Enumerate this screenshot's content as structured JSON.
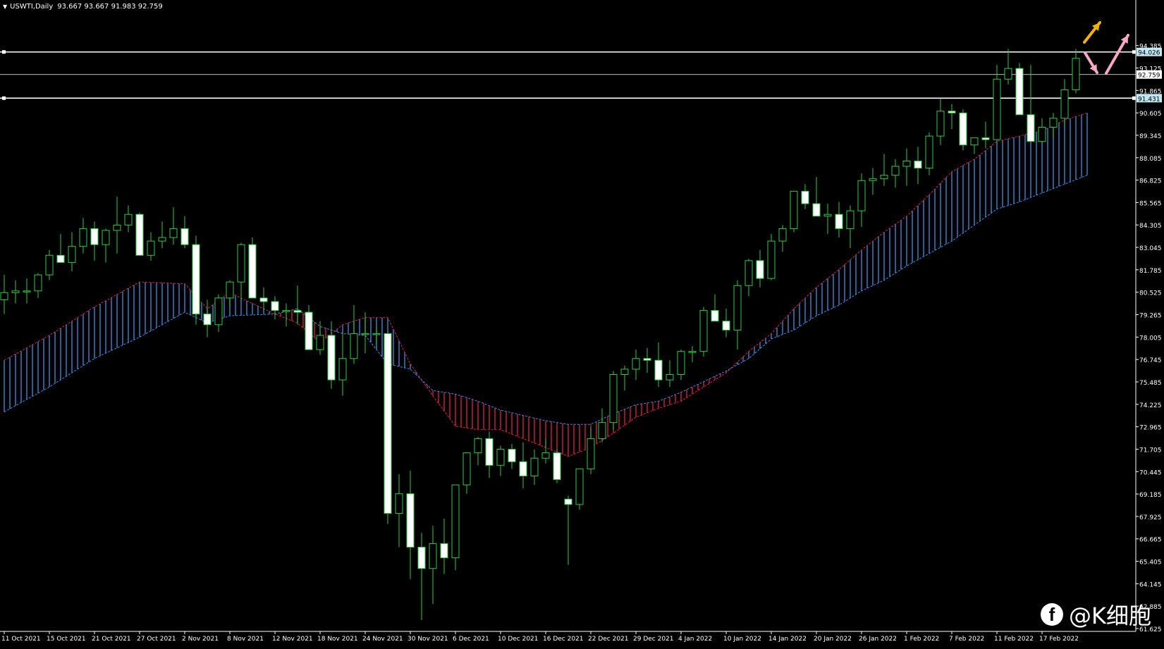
{
  "header": {
    "symbol_label": "USWTI,Daily",
    "ohlc_label": "93.667 93.667 91.983 92.759"
  },
  "watermark": {
    "icon": "facebook-icon",
    "text": "@K细胞"
  },
  "colors": {
    "background": "#000000",
    "bull_candle": "#000000",
    "bear_candle": "#ffffff",
    "wick": "#2ecc40",
    "cloud_bull": "#3d8fe6",
    "cloud_bear": "#e0214a",
    "hline": "#ffffff",
    "arrow_up_yellow": "#f0b400",
    "arrow_pink": "#f7a8c8",
    "axis_text": "#ffffff"
  },
  "chart_data": {
    "type": "candlestick",
    "symbol": "USWTI",
    "timeframe": "Daily",
    "ylim": [
      61.625,
      95.6
    ],
    "y_ticks": [
      "94.385",
      "93.125",
      "91.865",
      "90.605",
      "89.345",
      "88.085",
      "86.825",
      "85.565",
      "84.305",
      "83.045",
      "81.785",
      "80.525",
      "79.265",
      "78.005",
      "76.745",
      "75.485",
      "74.225",
      "72.965",
      "71.705",
      "70.445",
      "69.185",
      "67.925",
      "66.665",
      "65.405",
      "64.145",
      "62.885",
      "61.625"
    ],
    "x_ticks": [
      {
        "label": "11 Oct 2021",
        "i": 0
      },
      {
        "label": "15 Oct 2021",
        "i": 4
      },
      {
        "label": "21 Oct 2021",
        "i": 8
      },
      {
        "label": "27 Oct 2021",
        "i": 12
      },
      {
        "label": "2 Nov 2021",
        "i": 16
      },
      {
        "label": "8 Nov 2021",
        "i": 20
      },
      {
        "label": "12 Nov 2021",
        "i": 24
      },
      {
        "label": "18 Nov 2021",
        "i": 28
      },
      {
        "label": "24 Nov 2021",
        "i": 32
      },
      {
        "label": "30 Nov 2021",
        "i": 36
      },
      {
        "label": "6 Dec 2021",
        "i": 40
      },
      {
        "label": "10 Dec 2021",
        "i": 44
      },
      {
        "label": "16 Dec 2021",
        "i": 48
      },
      {
        "label": "22 Dec 2021",
        "i": 52
      },
      {
        "label": "29 Dec 2021",
        "i": 56
      },
      {
        "label": "4 Jan 2022",
        "i": 60
      },
      {
        "label": "10 Jan 2022",
        "i": 64
      },
      {
        "label": "14 Jan 2022",
        "i": 68
      },
      {
        "label": "20 Jan 2022",
        "i": 72
      },
      {
        "label": "26 Jan 2022",
        "i": 76
      },
      {
        "label": "1 Feb 2022",
        "i": 80
      },
      {
        "label": "7 Feb 2022",
        "i": 84
      },
      {
        "label": "11 Feb 2022",
        "i": 88
      },
      {
        "label": "17 Feb 2022",
        "i": 92
      }
    ],
    "horizontal_levels": [
      {
        "value": 94.026,
        "label": "94.026",
        "style": "thick"
      },
      {
        "value": 92.759,
        "label": "92.759",
        "style": "thin"
      },
      {
        "value": 91.431,
        "label": "91.431",
        "style": "thick"
      }
    ],
    "candles": [
      [
        0,
        80.1,
        81.5,
        79.3,
        80.5
      ],
      [
        1,
        80.5,
        81.2,
        79.9,
        80.6
      ],
      [
        2,
        80.6,
        81.3,
        79.9,
        80.6
      ],
      [
        3,
        80.6,
        81.6,
        80.2,
        81.5
      ],
      [
        4,
        81.5,
        82.9,
        81.2,
        82.6
      ],
      [
        5,
        82.6,
        83.8,
        82.3,
        82.2
      ],
      [
        6,
        82.2,
        83.9,
        81.7,
        83.1
      ],
      [
        7,
        83.1,
        84.7,
        82.7,
        84.1
      ],
      [
        8,
        84.1,
        84.5,
        82.3,
        83.2
      ],
      [
        9,
        83.2,
        84.1,
        82.2,
        84.0
      ],
      [
        10,
        84.0,
        85.9,
        82.7,
        84.3
      ],
      [
        11,
        84.3,
        85.4,
        83.9,
        84.9
      ],
      [
        12,
        84.9,
        85.0,
        83.0,
        82.6
      ],
      [
        13,
        82.6,
        83.9,
        82.3,
        83.4
      ],
      [
        14,
        83.4,
        84.5,
        83.0,
        83.6
      ],
      [
        15,
        83.6,
        85.3,
        83.2,
        84.1
      ],
      [
        16,
        84.1,
        84.8,
        83.0,
        83.2
      ],
      [
        17,
        83.2,
        83.7,
        78.7,
        79.3
      ],
      [
        18,
        79.3,
        80.1,
        78.0,
        78.7
      ],
      [
        19,
        78.7,
        80.4,
        78.3,
        80.2
      ],
      [
        20,
        80.2,
        81.2,
        79.7,
        81.1
      ],
      [
        21,
        81.1,
        83.3,
        80.1,
        83.2
      ],
      [
        22,
        83.2,
        83.6,
        81.9,
        80.2
      ],
      [
        23,
        80.2,
        80.8,
        79.5,
        80.0
      ],
      [
        24,
        80.0,
        80.3,
        79.0,
        79.5
      ],
      [
        25,
        79.5,
        79.9,
        78.6,
        79.5
      ],
      [
        26,
        79.5,
        80.9,
        78.7,
        79.4
      ],
      [
        27,
        79.4,
        79.8,
        77.9,
        77.3
      ],
      [
        28,
        77.3,
        78.9,
        77.0,
        78.1
      ],
      [
        29,
        78.1,
        78.9,
        75.1,
        75.6
      ],
      [
        30,
        75.6,
        78.3,
        74.7,
        76.8
      ],
      [
        31,
        76.8,
        79.8,
        76.5,
        78.2
      ],
      [
        32,
        78.2,
        79.4,
        77.1,
        78.2
      ],
      [
        33,
        78.2,
        78.6,
        77.6,
        78.2
      ],
      [
        34,
        78.2,
        78.1,
        67.5,
        68.1
      ],
      [
        35,
        68.1,
        70.3,
        66.2,
        69.2
      ],
      [
        36,
        69.2,
        70.5,
        64.4,
        66.2
      ],
      [
        37,
        66.2,
        67.0,
        62.1,
        65.0
      ],
      [
        38,
        65.0,
        67.4,
        63.0,
        66.4
      ],
      [
        39,
        66.4,
        67.8,
        64.7,
        65.6
      ],
      [
        40,
        65.6,
        69.5,
        64.9,
        69.7
      ],
      [
        41,
        69.7,
        71.4,
        69.2,
        71.5
      ],
      [
        42,
        71.5,
        72.4,
        70.8,
        72.3
      ],
      [
        43,
        72.3,
        72.7,
        70.1,
        70.8
      ],
      [
        44,
        70.8,
        71.9,
        70.2,
        71.7
      ],
      [
        45,
        71.7,
        72.0,
        70.6,
        71.0
      ],
      [
        46,
        71.0,
        72.1,
        69.5,
        70.2
      ],
      [
        47,
        70.2,
        71.7,
        69.7,
        71.2
      ],
      [
        48,
        71.2,
        72.3,
        70.9,
        71.5
      ],
      [
        49,
        71.5,
        71.7,
        69.8,
        70.0
      ],
      [
        50,
        68.9,
        69.1,
        65.2,
        68.6
      ],
      [
        51,
        68.6,
        70.6,
        68.3,
        70.6
      ],
      [
        52,
        70.6,
        72.9,
        70.3,
        72.3
      ],
      [
        53,
        72.3,
        74.0,
        72.1,
        73.2
      ],
      [
        54,
        73.2,
        76.1,
        72.8,
        75.9
      ],
      [
        55,
        75.9,
        76.4,
        75.0,
        76.2
      ],
      [
        56,
        76.2,
        77.3,
        75.6,
        76.8
      ],
      [
        57,
        76.8,
        77.4,
        76.0,
        76.7
      ],
      [
        58,
        76.7,
        77.7,
        75.2,
        75.6
      ],
      [
        59,
        75.6,
        76.7,
        75.2,
        75.9
      ],
      [
        60,
        75.9,
        77.3,
        75.6,
        77.2
      ],
      [
        61,
        77.2,
        77.5,
        76.6,
        77.2
      ],
      [
        62,
        77.2,
        79.7,
        76.9,
        79.5
      ],
      [
        63,
        79.5,
        80.4,
        79.1,
        78.9
      ],
      [
        64,
        78.9,
        79.6,
        78.0,
        78.4
      ],
      [
        65,
        78.4,
        81.2,
        77.3,
        80.9
      ],
      [
        66,
        80.9,
        82.4,
        80.3,
        82.3
      ],
      [
        67,
        82.3,
        82.9,
        80.8,
        81.3
      ],
      [
        68,
        81.3,
        83.8,
        81.2,
        83.4
      ],
      [
        69,
        83.4,
        84.3,
        82.8,
        84.1
      ],
      [
        70,
        84.1,
        86.2,
        83.9,
        86.2
      ],
      [
        71,
        86.2,
        86.6,
        85.2,
        85.5
      ],
      [
        72,
        85.5,
        87.0,
        84.8,
        84.8
      ],
      [
        73,
        84.8,
        85.5,
        83.8,
        84.9
      ],
      [
        74,
        84.9,
        85.6,
        83.6,
        84.1
      ],
      [
        75,
        84.1,
        85.4,
        83.0,
        85.1
      ],
      [
        76,
        85.1,
        87.2,
        84.2,
        86.8
      ],
      [
        77,
        86.8,
        87.5,
        86.0,
        86.9
      ],
      [
        78,
        86.9,
        88.3,
        86.5,
        87.1
      ],
      [
        79,
        87.1,
        88.0,
        86.4,
        87.6
      ],
      [
        80,
        87.6,
        88.6,
        86.5,
        87.9
      ],
      [
        81,
        87.9,
        88.7,
        86.6,
        87.5
      ],
      [
        82,
        87.5,
        89.5,
        87.1,
        89.3
      ],
      [
        83,
        89.3,
        91.4,
        88.8,
        90.7
      ],
      [
        84,
        90.7,
        91.1,
        89.7,
        90.6
      ],
      [
        85,
        90.6,
        90.8,
        88.5,
        88.8
      ],
      [
        86,
        88.8,
        89.2,
        88.3,
        89.2
      ],
      [
        87,
        89.2,
        90.1,
        88.6,
        89.1
      ],
      [
        88,
        89.1,
        93.3,
        88.9,
        92.5
      ],
      [
        89,
        92.5,
        94.2,
        92.2,
        93.1
      ],
      [
        90,
        93.1,
        93.4,
        91.2,
        90.5
      ],
      [
        91,
        90.5,
        93.3,
        89.7,
        89.0
      ],
      [
        92,
        89.0,
        90.3,
        88.9,
        89.8
      ],
      [
        93,
        89.8,
        90.6,
        89.2,
        90.3
      ],
      [
        94,
        90.3,
        92.5,
        89.9,
        91.9
      ],
      [
        95,
        91.9,
        94.2,
        91.7,
        93.667
      ]
    ],
    "cloud": {
      "span_a": [
        [
          0,
          76.7
        ],
        [
          4,
          78.1
        ],
        [
          8,
          79.7
        ],
        [
          12,
          81.1
        ],
        [
          16,
          81.0
        ],
        [
          18,
          79.6
        ],
        [
          20,
          80.5
        ],
        [
          24,
          79.3
        ],
        [
          26,
          78.8
        ],
        [
          28,
          77.7
        ],
        [
          30,
          78.7
        ],
        [
          32,
          79.1
        ],
        [
          34,
          79.1
        ],
        [
          36,
          76.5
        ],
        [
          38,
          74.7
        ],
        [
          40,
          73.0
        ],
        [
          42,
          72.8
        ],
        [
          44,
          72.8
        ],
        [
          46,
          72.3
        ],
        [
          48,
          71.8
        ],
        [
          50,
          71.3
        ],
        [
          52,
          71.8
        ],
        [
          54,
          72.6
        ],
        [
          56,
          73.5
        ],
        [
          58,
          74.0
        ],
        [
          60,
          74.4
        ],
        [
          62,
          75.2
        ],
        [
          64,
          76.0
        ],
        [
          66,
          77.2
        ],
        [
          68,
          78.2
        ],
        [
          70,
          79.6
        ],
        [
          72,
          80.8
        ],
        [
          74,
          81.8
        ],
        [
          76,
          82.9
        ],
        [
          78,
          83.9
        ],
        [
          80,
          84.8
        ],
        [
          82,
          86.0
        ],
        [
          84,
          87.3
        ],
        [
          86,
          88.0
        ],
        [
          88,
          89.0
        ],
        [
          90,
          89.3
        ],
        [
          92,
          89.6
        ],
        [
          94,
          90.2
        ],
        [
          96,
          90.6
        ]
      ],
      "span_b": [
        [
          0,
          73.8
        ],
        [
          4,
          75.2
        ],
        [
          8,
          76.8
        ],
        [
          12,
          78.0
        ],
        [
          16,
          79.4
        ],
        [
          18,
          78.8
        ],
        [
          20,
          79.2
        ],
        [
          24,
          79.3
        ],
        [
          26,
          79.6
        ],
        [
          28,
          78.6
        ],
        [
          30,
          78.2
        ],
        [
          32,
          78.1
        ],
        [
          34,
          76.5
        ],
        [
          36,
          76.2
        ],
        [
          38,
          75.0
        ],
        [
          40,
          74.8
        ],
        [
          42,
          74.4
        ],
        [
          44,
          73.9
        ],
        [
          46,
          73.6
        ],
        [
          48,
          73.3
        ],
        [
          50,
          73.1
        ],
        [
          52,
          73.1
        ],
        [
          54,
          73.7
        ],
        [
          56,
          74.2
        ],
        [
          58,
          74.4
        ],
        [
          60,
          74.9
        ],
        [
          62,
          75.5
        ],
        [
          64,
          76.1
        ],
        [
          66,
          76.8
        ],
        [
          68,
          77.9
        ],
        [
          70,
          78.4
        ],
        [
          72,
          79.2
        ],
        [
          74,
          79.8
        ],
        [
          76,
          80.6
        ],
        [
          78,
          81.2
        ],
        [
          80,
          82.0
        ],
        [
          82,
          82.7
        ],
        [
          84,
          83.4
        ],
        [
          86,
          84.3
        ],
        [
          88,
          85.2
        ],
        [
          90,
          85.6
        ],
        [
          92,
          86.1
        ],
        [
          94,
          86.6
        ],
        [
          96,
          87.1
        ]
      ]
    }
  }
}
